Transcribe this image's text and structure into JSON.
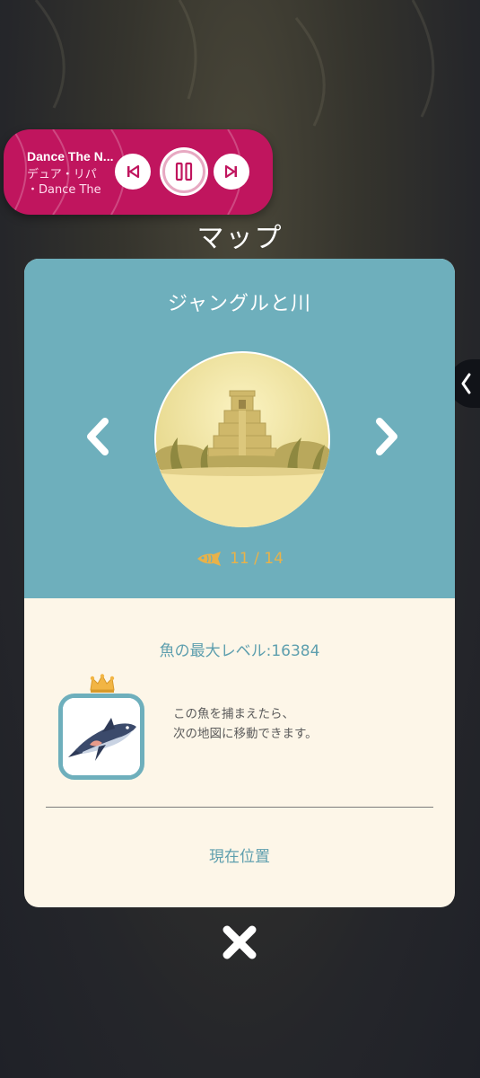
{
  "screen_title": "マップ",
  "music": {
    "title": "Dance The N...",
    "artist_line1": "デュア・リパ",
    "artist_line2": "・Dance The"
  },
  "map_card": {
    "area_name": "ジャングルと川",
    "fish_count": "11 / 14",
    "max_level": "魚の最大レベル:16384",
    "description_line1": "この魚を捕まえたら、",
    "description_line2": "次の地図に移動できます。",
    "current_position": "現在位置"
  },
  "icons": {
    "prev": "skip-previous-icon",
    "pause": "pause-icon",
    "next": "skip-next-icon",
    "left_arrow": "chevron-left-icon",
    "right_arrow": "chevron-right-icon",
    "fish": "fish-icon",
    "crown": "crown-icon",
    "close": "close-icon",
    "side_tab": "chevron-left-icon"
  },
  "colors": {
    "music_bg": "#c0155e",
    "card_top": "#6eafbc",
    "card_bottom": "#fdf6e8",
    "accent_gold": "#e8b24a",
    "text_teal": "#5e9fae"
  }
}
